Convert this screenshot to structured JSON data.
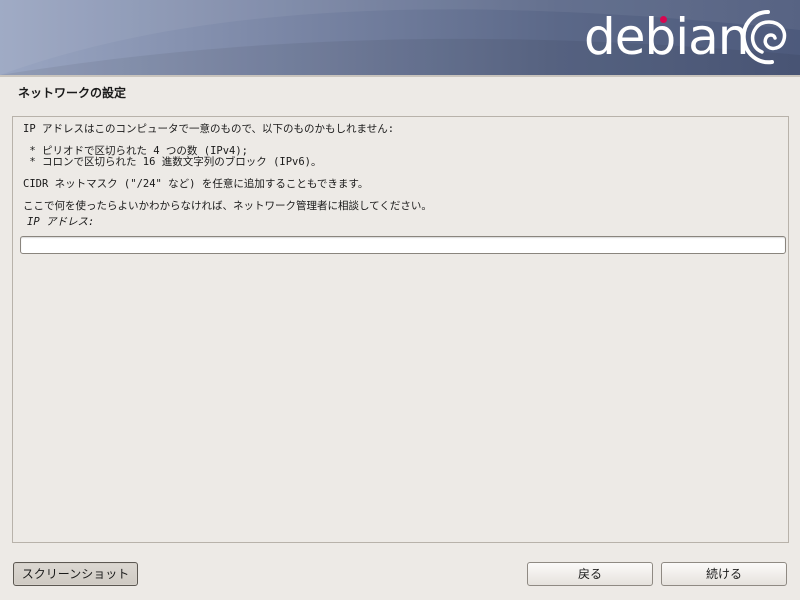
{
  "banner": {
    "logo_text": "debian",
    "brand_color": "#d70751",
    "logo_icon": "debian-swirl-icon"
  },
  "dialog": {
    "title": "ネットワークの設定",
    "description": {
      "line1": "IP アドレスはこのコンピュータで一意のもので、以下のものかもしれません:",
      "bullet1": " * ピリオドで区切られた 4 つの数 (IPv4);",
      "bullet2": " * コロンで区切られた 16 進数文字列のブロック (IPv6)。",
      "line2": "CIDR ネットマスク (\"/24\" など) を任意に追加することもできます。",
      "line3": "ここで何を使ったらよいかわからなければ、ネットワーク管理者に相談してください。"
    },
    "field_label": "IP アドレス:",
    "ip_value": ""
  },
  "buttons": {
    "screenshot": "スクリーンショット",
    "back": "戻る",
    "continue": "続ける"
  }
}
